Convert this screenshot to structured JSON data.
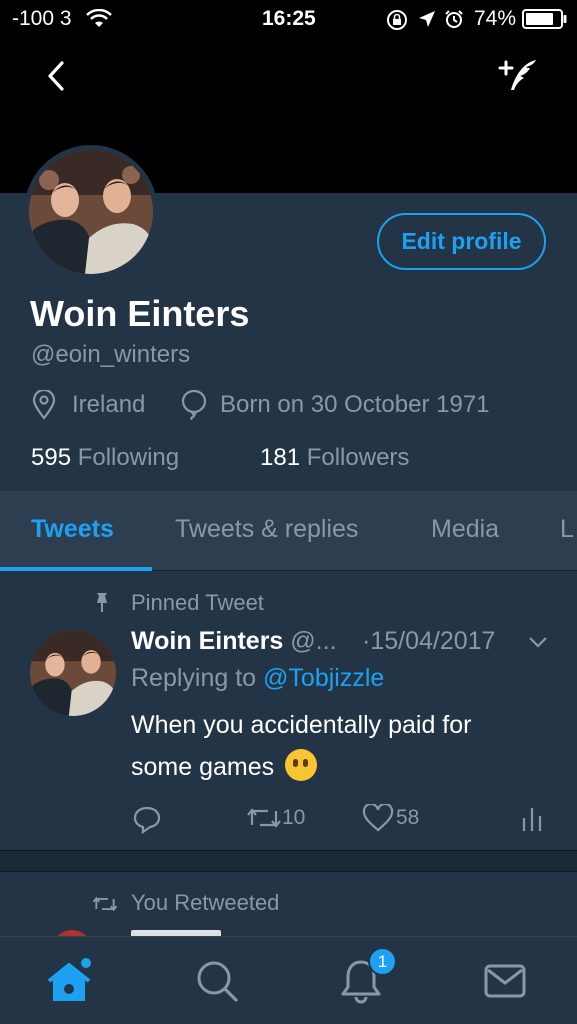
{
  "status_bar": {
    "signal": "-100 3",
    "time": "16:25",
    "battery": "74%",
    "icons": [
      "wifi-icon",
      "rotation-lock-icon",
      "location-icon",
      "alarm-icon",
      "battery-icon"
    ]
  },
  "header": {
    "back_icon": "chevron-left-icon",
    "compose_icon": "compose-quill-icon"
  },
  "profile": {
    "edit_label": "Edit profile",
    "name": "Woin Einters",
    "handle": "@eoin_winters",
    "location": "Ireland",
    "born": "Born on 30 October 1971",
    "following_count": "595",
    "following_label": "Following",
    "followers_count": "181",
    "followers_label": "Followers"
  },
  "tabs": [
    "Tweets",
    "Tweets & replies",
    "Media",
    "L"
  ],
  "active_tab": "Tweets",
  "pinned_tweet": {
    "pinned_label": "Pinned Tweet",
    "author_name": "Woin Einters",
    "author_handle": "@...",
    "date": "·15/04/2017",
    "replying_prefix": "Replying to",
    "replying_handle": "@Tobjizzle",
    "text_line1": "When you accidentally paid for",
    "text_line2": "some games",
    "emoji": "hushed-face-emoji",
    "retweets": "10",
    "likes": "58"
  },
  "next_tweet": {
    "retweeted_label": "You Retweeted"
  },
  "bottom_nav": {
    "items": [
      "home-icon",
      "search-icon",
      "notifications-icon",
      "messages-icon"
    ],
    "notification_badge": "1"
  },
  "colors": {
    "accent": "#1da1f2",
    "background": "#243447",
    "muted_text": "#8899a6"
  }
}
